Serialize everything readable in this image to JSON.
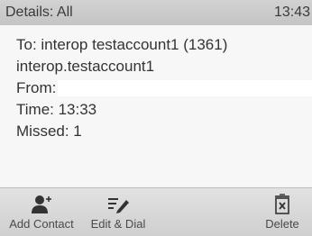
{
  "status_bar": {
    "title": "Details: All",
    "time": "13:43"
  },
  "details": {
    "to": "To: interop testaccount1 (1361)",
    "account": "interop.testaccount1",
    "from_label": "From:",
    "time": "Time: 13:33",
    "missed": "Missed: 1"
  },
  "softkeys": {
    "add_contact": {
      "label": "Add Contact",
      "icon": "add-contact-icon"
    },
    "edit_dial": {
      "label": "Edit & Dial",
      "icon": "edit-icon"
    },
    "delete": {
      "label": "Delete",
      "icon": "delete-icon"
    }
  },
  "colors": {
    "status_bar_bg": "#c8c8c8",
    "text": "#333333",
    "icon": "#333333"
  }
}
